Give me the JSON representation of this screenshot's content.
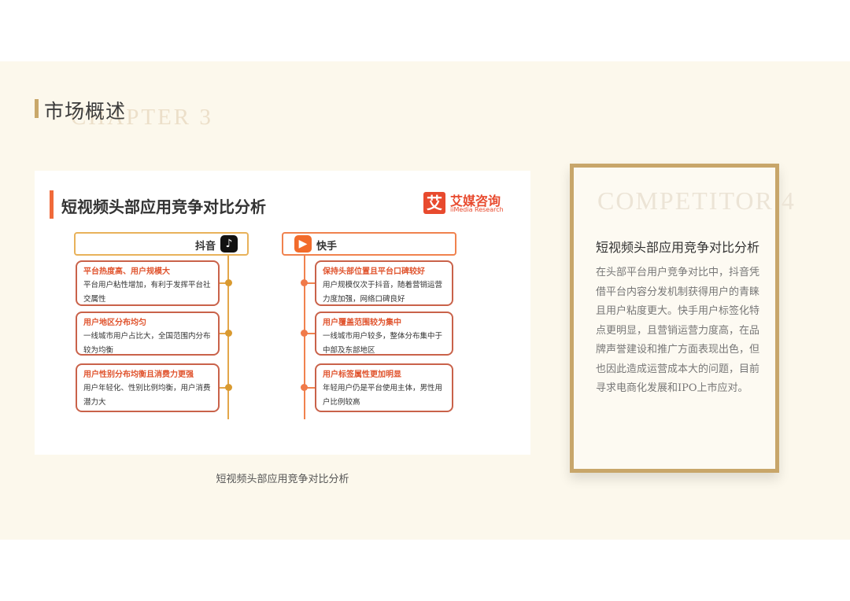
{
  "header": {
    "title": "市场概述",
    "chapter": "CHAPTER 3"
  },
  "figure": {
    "title": "短视频头部应用竞争对比分析",
    "logo": {
      "cn": "艾媒咨询",
      "en": "iiMedia Research",
      "mark": "艾"
    },
    "douyin": {
      "name": "抖音",
      "icon": "tiktok-icon",
      "items": [
        {
          "heading": "平台热度高、用户规模大",
          "body": "平台用户粘性增加，有利于发挥平台社交属性"
        },
        {
          "heading": "用户地区分布均匀",
          "body": "一线城市用户占比大，全国范围内分布较为均衡"
        },
        {
          "heading": "用户性别分布均衡且消费力更强",
          "body": "用户年轻化、性别比例均衡，用户消费潜力大"
        }
      ]
    },
    "kuaishou": {
      "name": "快手",
      "icon": "kuaishou-icon",
      "items": [
        {
          "heading": "保持头部位置且平台口碑较好",
          "body": "用户规模仅次于抖音，随着营销运营力度加强，网络口碑良好"
        },
        {
          "heading": "用户覆盖范围较为集中",
          "body": "一线城市用户较多，整体分布集中于中部及东部地区"
        },
        {
          "heading": "用户标签属性更加明显",
          "body": "年轻用户仍是平台使用主体，男性用户比例较高"
        }
      ]
    }
  },
  "caption": "短视频头部应用竞争对比分析",
  "side": {
    "watermark": "COMPETITOR 4",
    "title": "短视频头部应用竞争对比分析",
    "body": "在头部平台用户竞争对比中，抖音凭借平台内容分发机制获得用户的青睐且用户粘度更大。快手用户标签化特点更明显，且营销运营力度高，在品牌声誉建设和推广方面表现出色，但也因此造成运营成本大的问题，目前寻求电商化发展和IPO上市应对。"
  }
}
